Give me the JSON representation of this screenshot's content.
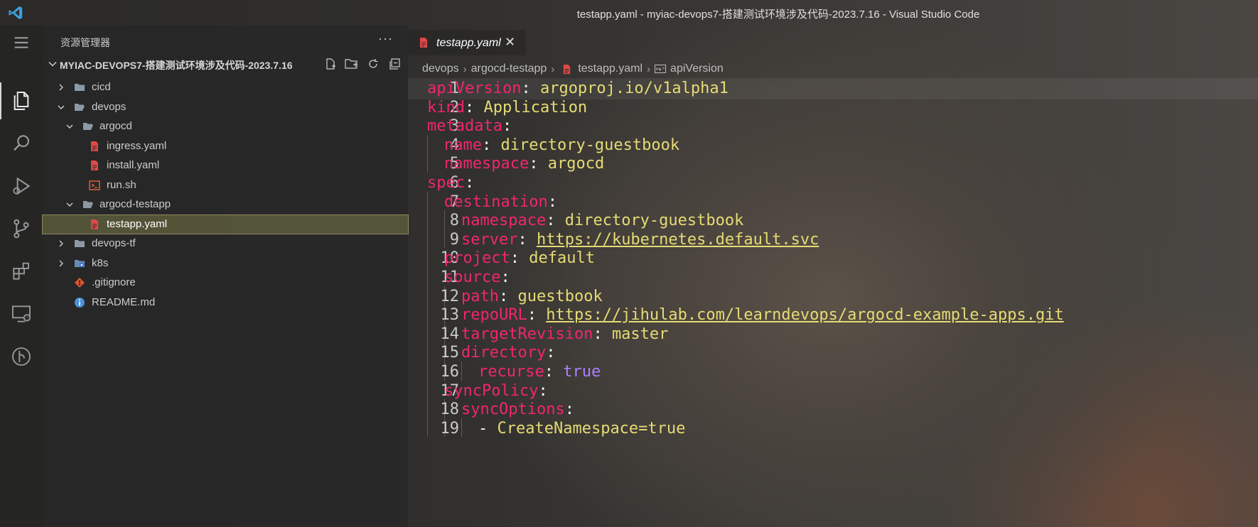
{
  "window": {
    "title": "testapp.yaml - myiac-devops7-搭建测试环境涉及代码-2023.7.16 - Visual Studio Code"
  },
  "sidebar": {
    "title": "资源管理器",
    "more": "···",
    "folder_name": "MYIAC-DEVOPS7-搭建测试环境涉及代码-2023.7.16",
    "tree": [
      {
        "label": "cicd",
        "type": "folder",
        "depth": 0,
        "expanded": false
      },
      {
        "label": "devops",
        "type": "folder",
        "depth": 0,
        "expanded": true
      },
      {
        "label": "argocd",
        "type": "folder",
        "depth": 1,
        "expanded": true
      },
      {
        "label": "ingress.yaml",
        "type": "yaml",
        "depth": 2
      },
      {
        "label": "install.yaml",
        "type": "yaml",
        "depth": 2
      },
      {
        "label": "run.sh",
        "type": "shell",
        "depth": 2
      },
      {
        "label": "argocd-testapp",
        "type": "folder",
        "depth": 1,
        "expanded": true
      },
      {
        "label": "testapp.yaml",
        "type": "yaml",
        "depth": 2,
        "selected": true
      },
      {
        "label": "devops-tf",
        "type": "folder",
        "depth": 0,
        "expanded": false
      },
      {
        "label": "k8s",
        "type": "folder-k8s",
        "depth": 0,
        "expanded": false
      },
      {
        "label": ".gitignore",
        "type": "git",
        "depth": 0
      },
      {
        "label": "README.md",
        "type": "info",
        "depth": 0
      }
    ]
  },
  "editor": {
    "tab": {
      "label": "testapp.yaml",
      "close": "✕"
    },
    "breadcrumb": [
      "devops",
      "argocd-testapp",
      "testapp.yaml",
      "apiVersion"
    ],
    "breadcrumb_sep": "›",
    "lines": [
      {
        "n": "1",
        "indent": 0,
        "parts": [
          [
            "k",
            "apiVersion"
          ],
          [
            "p",
            ": "
          ],
          [
            "s",
            "argoproj.io/v1alpha1"
          ]
        ]
      },
      {
        "n": "2",
        "indent": 0,
        "parts": [
          [
            "k",
            "kind"
          ],
          [
            "p",
            ": "
          ],
          [
            "s",
            "Application"
          ]
        ]
      },
      {
        "n": "3",
        "indent": 0,
        "parts": [
          [
            "k",
            "metadata"
          ],
          [
            "p",
            ":"
          ]
        ]
      },
      {
        "n": "4",
        "indent": 1,
        "parts": [
          [
            "k",
            "name"
          ],
          [
            "p",
            ": "
          ],
          [
            "s",
            "directory-guestbook"
          ]
        ]
      },
      {
        "n": "5",
        "indent": 1,
        "parts": [
          [
            "k",
            "namespace"
          ],
          [
            "p",
            ": "
          ],
          [
            "s",
            "argocd"
          ]
        ]
      },
      {
        "n": "6",
        "indent": 0,
        "parts": [
          [
            "k",
            "spec"
          ],
          [
            "p",
            ":"
          ]
        ]
      },
      {
        "n": "7",
        "indent": 1,
        "parts": [
          [
            "k",
            "destination"
          ],
          [
            "p",
            ":"
          ]
        ]
      },
      {
        "n": "8",
        "indent": 2,
        "parts": [
          [
            "k",
            "namespace"
          ],
          [
            "p",
            ": "
          ],
          [
            "s",
            "directory-guestbook"
          ]
        ]
      },
      {
        "n": "9",
        "indent": 2,
        "parts": [
          [
            "k",
            "server"
          ],
          [
            "p",
            ": "
          ],
          [
            "u",
            "https://kubernetes.default.svc"
          ]
        ]
      },
      {
        "n": "10",
        "indent": 1,
        "parts": [
          [
            "k",
            "project"
          ],
          [
            "p",
            ": "
          ],
          [
            "s",
            "default"
          ]
        ]
      },
      {
        "n": "11",
        "indent": 1,
        "parts": [
          [
            "k",
            "source"
          ],
          [
            "p",
            ":"
          ]
        ]
      },
      {
        "n": "12",
        "indent": 2,
        "parts": [
          [
            "k",
            "path"
          ],
          [
            "p",
            ": "
          ],
          [
            "s",
            "guestbook"
          ]
        ]
      },
      {
        "n": "13",
        "indent": 2,
        "parts": [
          [
            "k",
            "repoURL"
          ],
          [
            "p",
            ": "
          ],
          [
            "u",
            "https://jihulab.com/learndevops/argocd-example-apps.git"
          ]
        ]
      },
      {
        "n": "14",
        "indent": 2,
        "parts": [
          [
            "k",
            "targetRevision"
          ],
          [
            "p",
            ": "
          ],
          [
            "s",
            "master"
          ]
        ]
      },
      {
        "n": "15",
        "indent": 2,
        "parts": [
          [
            "k",
            "directory"
          ],
          [
            "p",
            ":"
          ]
        ]
      },
      {
        "n": "16",
        "indent": 3,
        "parts": [
          [
            "k",
            "recurse"
          ],
          [
            "p",
            ": "
          ],
          [
            "b",
            "true"
          ]
        ]
      },
      {
        "n": "17",
        "indent": 1,
        "parts": [
          [
            "k",
            "syncPolicy"
          ],
          [
            "p",
            ":"
          ]
        ]
      },
      {
        "n": "18",
        "indent": 2,
        "parts": [
          [
            "k",
            "syncOptions"
          ],
          [
            "p",
            ":"
          ]
        ]
      },
      {
        "n": "19",
        "indent": 3,
        "parts": [
          [
            "p",
            "- "
          ],
          [
            "s",
            "CreateNamespace=true"
          ]
        ]
      }
    ]
  },
  "colors": {
    "key": "#f0266f",
    "string": "#e6db74",
    "boolean": "#ae81ff",
    "accent": "#3c9fe0"
  },
  "icons": {
    "activitybar": [
      "menu-icon",
      "explorer-icon",
      "search-icon",
      "run-debug-icon",
      "source-control-icon",
      "extensions-icon",
      "remote-explorer-icon",
      "gitlens-icon"
    ]
  }
}
